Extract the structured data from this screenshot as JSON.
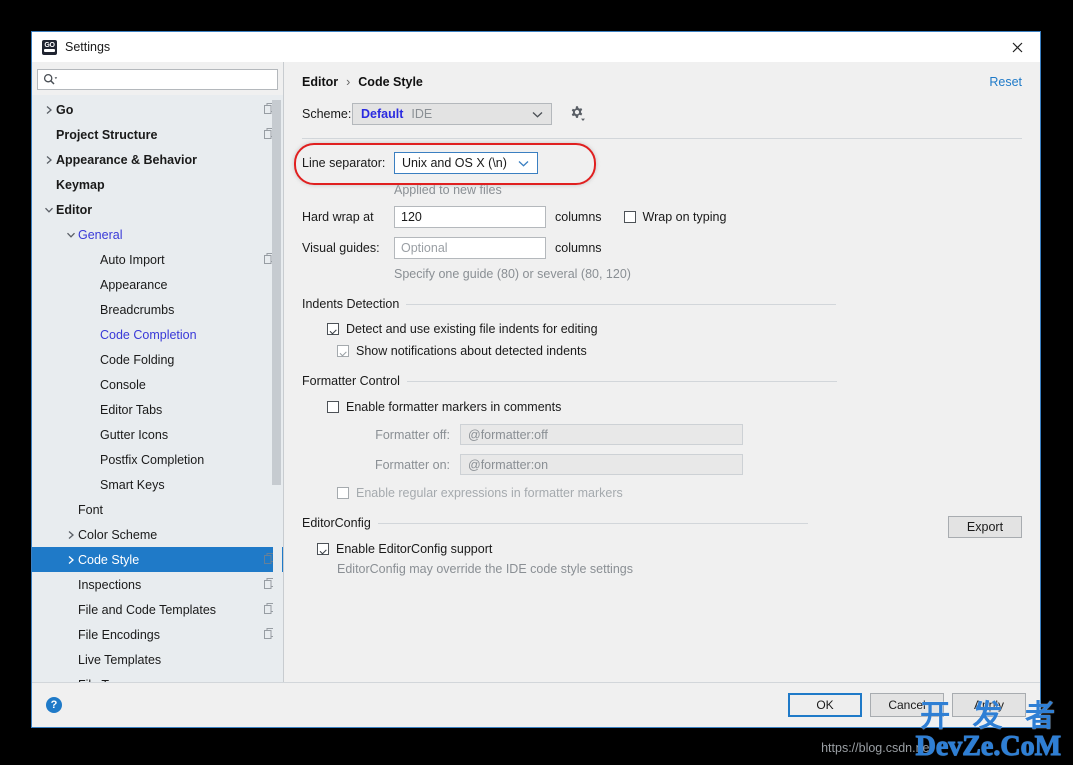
{
  "window": {
    "title": "Settings",
    "logo_icon": "goland-logo-icon",
    "close_icon": "close-icon"
  },
  "search": {
    "value": "",
    "placeholder": "",
    "icon": "search-icon",
    "dropdown_icon": "chevron-down-icon"
  },
  "sidebar": {
    "items": [
      {
        "label": "Go",
        "depth": 0,
        "arrow": "right",
        "bold": true,
        "modified": false,
        "selected": false,
        "copy": true
      },
      {
        "label": "Project Structure",
        "depth": 0,
        "arrow": "none",
        "bold": true,
        "modified": false,
        "selected": false,
        "copy": true
      },
      {
        "label": "Appearance & Behavior",
        "depth": 0,
        "arrow": "right",
        "bold": true,
        "modified": false,
        "selected": false,
        "copy": false
      },
      {
        "label": "Keymap",
        "depth": 0,
        "arrow": "none",
        "bold": true,
        "modified": false,
        "selected": false,
        "copy": false
      },
      {
        "label": "Editor",
        "depth": 0,
        "arrow": "down",
        "bold": true,
        "modified": false,
        "selected": false,
        "copy": false
      },
      {
        "label": "General",
        "depth": 1,
        "arrow": "down",
        "bold": false,
        "modified": true,
        "selected": false,
        "copy": false
      },
      {
        "label": "Auto Import",
        "depth": 2,
        "arrow": "none",
        "bold": false,
        "modified": false,
        "selected": false,
        "copy": true
      },
      {
        "label": "Appearance",
        "depth": 2,
        "arrow": "none",
        "bold": false,
        "modified": false,
        "selected": false,
        "copy": false
      },
      {
        "label": "Breadcrumbs",
        "depth": 2,
        "arrow": "none",
        "bold": false,
        "modified": false,
        "selected": false,
        "copy": false
      },
      {
        "label": "Code Completion",
        "depth": 2,
        "arrow": "none",
        "bold": false,
        "modified": true,
        "selected": false,
        "copy": false
      },
      {
        "label": "Code Folding",
        "depth": 2,
        "arrow": "none",
        "bold": false,
        "modified": false,
        "selected": false,
        "copy": false
      },
      {
        "label": "Console",
        "depth": 2,
        "arrow": "none",
        "bold": false,
        "modified": false,
        "selected": false,
        "copy": false
      },
      {
        "label": "Editor Tabs",
        "depth": 2,
        "arrow": "none",
        "bold": false,
        "modified": false,
        "selected": false,
        "copy": false
      },
      {
        "label": "Gutter Icons",
        "depth": 2,
        "arrow": "none",
        "bold": false,
        "modified": false,
        "selected": false,
        "copy": false
      },
      {
        "label": "Postfix Completion",
        "depth": 2,
        "arrow": "none",
        "bold": false,
        "modified": false,
        "selected": false,
        "copy": false
      },
      {
        "label": "Smart Keys",
        "depth": 2,
        "arrow": "none",
        "bold": false,
        "modified": false,
        "selected": false,
        "copy": false
      },
      {
        "label": "Font",
        "depth": 1,
        "arrow": "none",
        "bold": false,
        "modified": false,
        "selected": false,
        "copy": false
      },
      {
        "label": "Color Scheme",
        "depth": 1,
        "arrow": "right",
        "bold": false,
        "modified": false,
        "selected": false,
        "copy": false
      },
      {
        "label": "Code Style",
        "depth": 1,
        "arrow": "right",
        "bold": false,
        "modified": false,
        "selected": true,
        "copy": true
      },
      {
        "label": "Inspections",
        "depth": 1,
        "arrow": "none",
        "bold": false,
        "modified": false,
        "selected": false,
        "copy": true
      },
      {
        "label": "File and Code Templates",
        "depth": 1,
        "arrow": "none",
        "bold": false,
        "modified": false,
        "selected": false,
        "copy": true
      },
      {
        "label": "File Encodings",
        "depth": 1,
        "arrow": "none",
        "bold": false,
        "modified": false,
        "selected": false,
        "copy": true
      },
      {
        "label": "Live Templates",
        "depth": 1,
        "arrow": "none",
        "bold": false,
        "modified": false,
        "selected": false,
        "copy": false
      },
      {
        "label": "File Types",
        "depth": 1,
        "arrow": "none",
        "bold": false,
        "modified": false,
        "selected": false,
        "copy": false
      }
    ]
  },
  "main": {
    "breadcrumb": {
      "root": "Editor",
      "separator": "›",
      "leaf": "Code Style"
    },
    "reset_label": "Reset",
    "scheme": {
      "label": "Scheme:",
      "value": "Default",
      "suffix": "IDE",
      "gear_icon": "gear-icon",
      "arrow_icon": "chevron-down-icon"
    },
    "line_separator": {
      "label": "Line separator:",
      "value": "Unix and OS X (\\n)",
      "hint": "Applied to new files",
      "arrow_icon": "chevron-down-icon"
    },
    "hard_wrap": {
      "label": "Hard wrap at",
      "value": "120",
      "unit": "columns"
    },
    "wrap_on_typing": {
      "label": "Wrap on typing",
      "checked": false
    },
    "visual_guides": {
      "label": "Visual guides:",
      "value": "",
      "placeholder": "Optional",
      "unit": "columns",
      "hint": "Specify one guide (80) or several (80, 120)"
    },
    "indents_detection": {
      "title": "Indents Detection",
      "detect": {
        "label": "Detect and use existing file indents for editing",
        "checked": true,
        "disabled": false
      },
      "notify": {
        "label": "Show notifications about detected indents",
        "checked": true,
        "disabled": true
      }
    },
    "formatter_control": {
      "title": "Formatter Control",
      "enable": {
        "label": "Enable formatter markers in comments",
        "checked": false
      },
      "off": {
        "label": "Formatter off:",
        "placeholder": "@formatter:off",
        "value": ""
      },
      "on": {
        "label": "Formatter on:",
        "placeholder": "@formatter:on",
        "value": ""
      },
      "regex": {
        "label": "Enable regular expressions in formatter markers",
        "checked": false,
        "disabled": true
      }
    },
    "editorconfig": {
      "title": "EditorConfig",
      "enable": {
        "label": "Enable EditorConfig support",
        "checked": true
      },
      "hint": "EditorConfig may override the IDE code style settings",
      "export_label": "Export"
    }
  },
  "footer": {
    "help_icon": "help-icon",
    "help_label": "?",
    "buttons": [
      {
        "label": "OK",
        "default": true
      },
      {
        "label": "Cancel",
        "default": false
      },
      {
        "label": "Apply",
        "default": false
      }
    ]
  },
  "watermark": {
    "url": "https://blog.csdn.net",
    "cn": "开 发 者",
    "en": "DevZe.CoM"
  },
  "colors": {
    "accent": "#1f7ac8",
    "selection": "#1f7ac8",
    "modified": "#3939d8",
    "annotation": "#e02020",
    "hint": "#8a8f94"
  }
}
